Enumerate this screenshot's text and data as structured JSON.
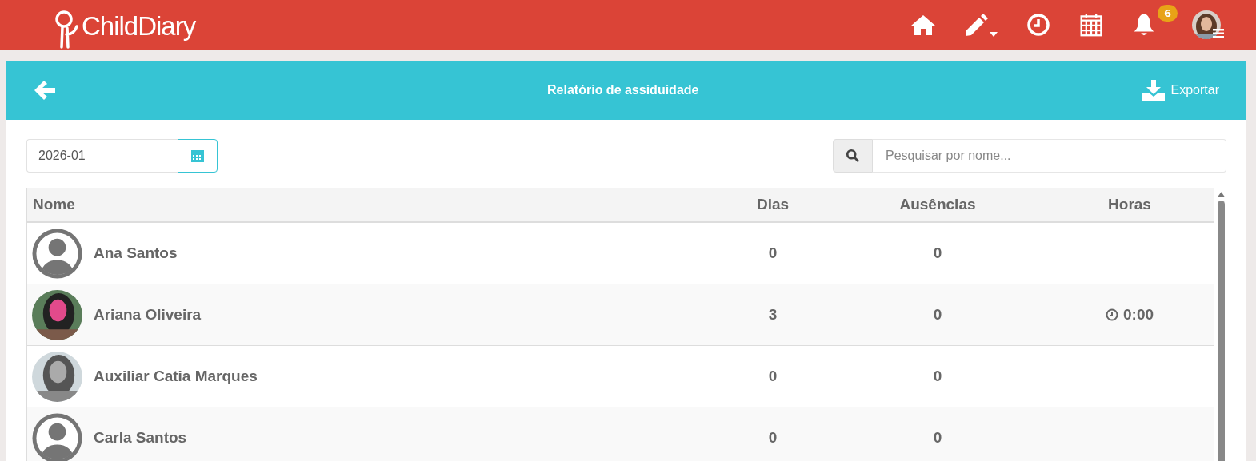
{
  "header": {
    "logo": "ChildDiary",
    "notifications_badge": "6"
  },
  "title_bar": {
    "title": "Relatório de assiduidade",
    "export": "Exportar"
  },
  "month_field": {
    "value": "2026-01"
  },
  "search": {
    "placeholder": "Pesquisar por nome..."
  },
  "table": {
    "columns": [
      "Nome",
      "Dias",
      "Ausências",
      "Horas"
    ],
    "rows": [
      {
        "avatar": {
          "kind": "placeholder"
        },
        "name": "Ana Santos",
        "days": "0",
        "absences": "0"
      },
      {
        "name": "Ariana Oliveira",
        "days": "3",
        "absences": "0",
        "hours": "0:00"
      },
      {
        "name": "Auxiliar Catia Marques",
        "days": "0",
        "absences": "0"
      },
      {
        "avatar": {
          "kind": "placeholder"
        },
        "name": "Carla Santos",
        "days": "0",
        "absences": "0"
      }
    ]
  }
}
